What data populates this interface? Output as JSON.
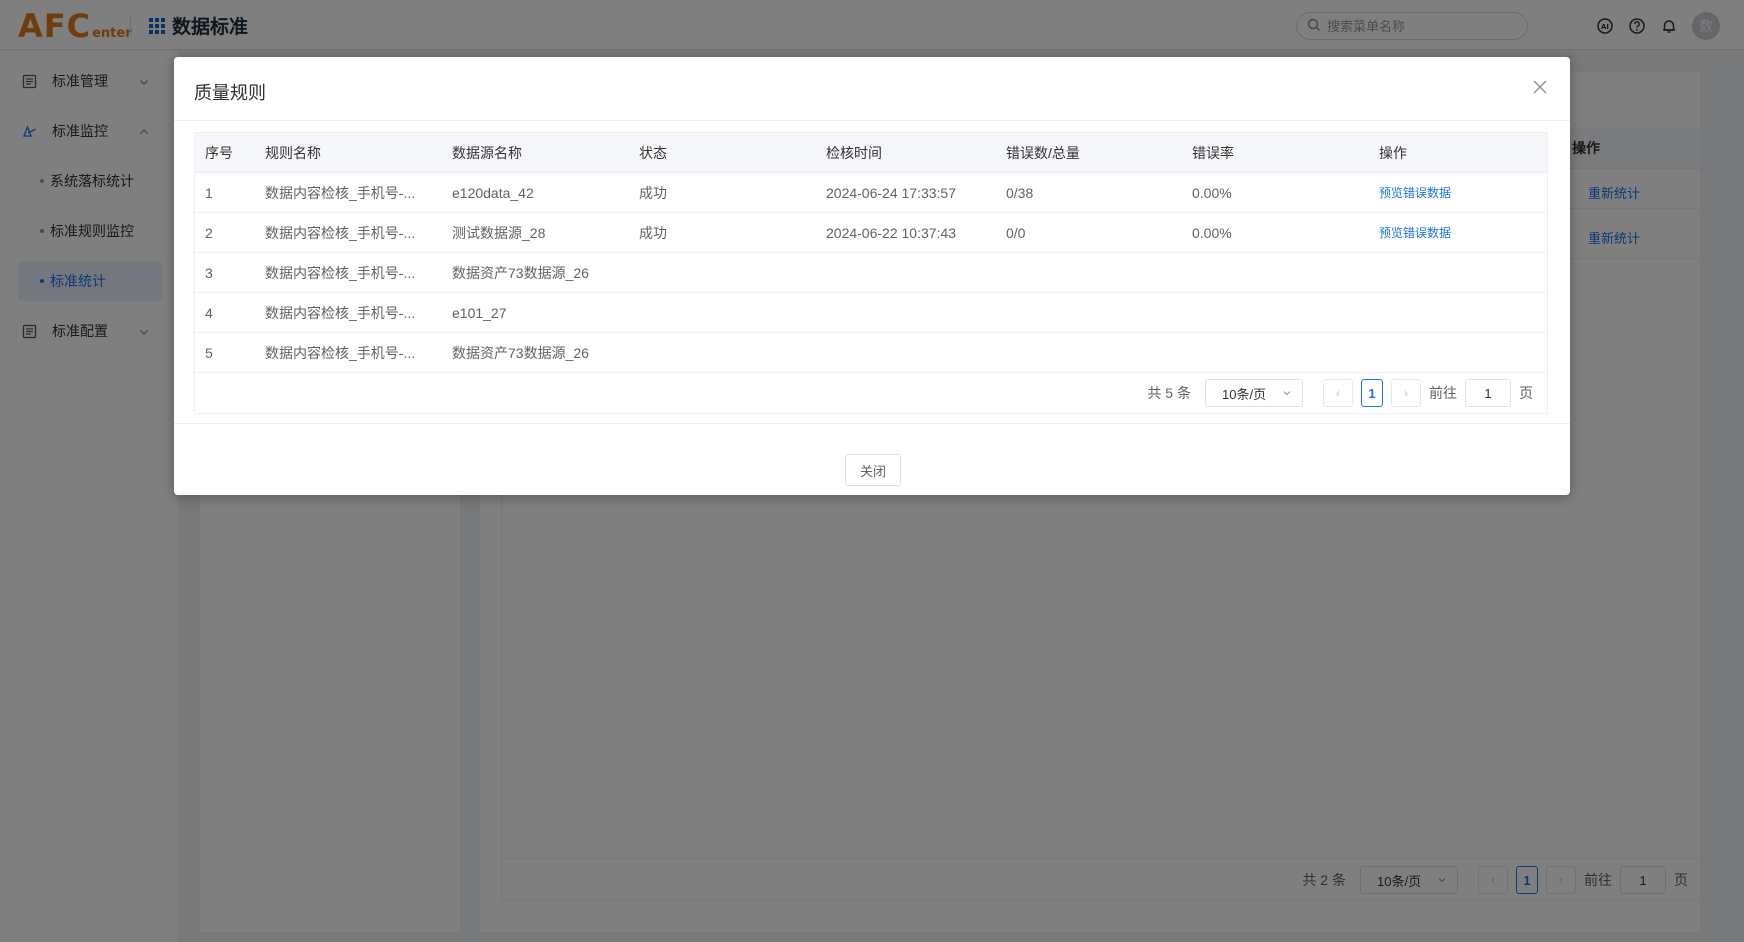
{
  "header": {
    "logo_big": "AFC",
    "logo_small": "enter",
    "app_title": "数据标准",
    "search_placeholder": "搜索菜单名称",
    "avatar_text": "数"
  },
  "sidebar": {
    "items": [
      {
        "label": "标准管理",
        "expanded": false
      },
      {
        "label": "标准监控",
        "expanded": true
      },
      {
        "label": "标准配置",
        "expanded": false
      }
    ],
    "sub_items": [
      {
        "label": "系统落标统计",
        "active": false
      },
      {
        "label": "标准规则监控",
        "active": false
      },
      {
        "label": "标准统计",
        "active": true
      }
    ]
  },
  "background": {
    "op_header": "操作",
    "row_links": [
      "重新统计",
      "重新统计"
    ],
    "pager": {
      "total": "共 2 条",
      "page_size": "10条/页",
      "current": "1",
      "goto_label": "前往",
      "goto_value": "1",
      "page_suffix": "页"
    }
  },
  "dialog": {
    "title": "质量规则",
    "columns": [
      "序号",
      "规则名称",
      "数据源名称",
      "状态",
      "检核时间",
      "错误数/总量",
      "错误率",
      "操作"
    ],
    "rows": [
      {
        "index": "1",
        "rule": "数据内容检核_手机号-...",
        "source": "e120data_42",
        "status": "成功",
        "time": "2024-06-24 17:33:57",
        "errors": "0/38",
        "rate": "0.00%",
        "action": "预览错误数据"
      },
      {
        "index": "2",
        "rule": "数据内容检核_手机号-...",
        "source": "测试数据源_28",
        "status": "成功",
        "time": "2024-06-22 10:37:43",
        "errors": "0/0",
        "rate": "0.00%",
        "action": "预览错误数据"
      },
      {
        "index": "3",
        "rule": "数据内容检核_手机号-...",
        "source": "数据资产73数据源_26",
        "status": "",
        "time": "",
        "errors": "",
        "rate": "",
        "action": ""
      },
      {
        "index": "4",
        "rule": "数据内容检核_手机号-...",
        "source": "e101_27",
        "status": "",
        "time": "",
        "errors": "",
        "rate": "",
        "action": ""
      },
      {
        "index": "5",
        "rule": "数据内容检核_手机号-...",
        "source": "数据资产73数据源_26",
        "status": "",
        "time": "",
        "errors": "",
        "rate": "",
        "action": ""
      }
    ],
    "pager": {
      "total": "共 5 条",
      "page_size": "10条/页",
      "current": "1",
      "goto_label": "前往",
      "goto_value": "1",
      "page_suffix": "页"
    },
    "close_label": "关闭"
  },
  "colors": {
    "accent": "#1a73e8",
    "logo": "#e07b18",
    "mask": "rgba(0,0,0,0.5)"
  }
}
